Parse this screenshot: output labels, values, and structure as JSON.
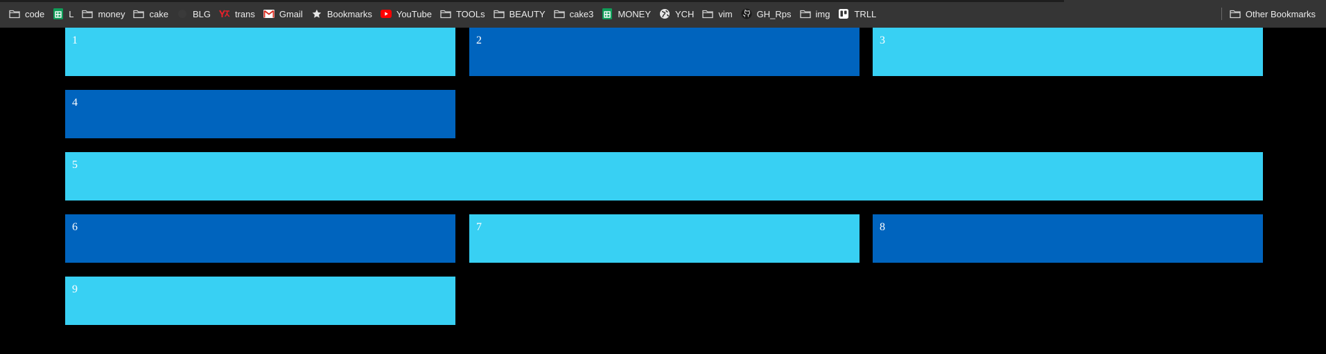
{
  "bookmarks_bar": {
    "items": [
      {
        "label": "code",
        "icon": "folder-icon"
      },
      {
        "label": "L",
        "icon": "sheets-icon"
      },
      {
        "label": "money",
        "icon": "folder-icon"
      },
      {
        "label": "cake",
        "icon": "folder-icon"
      },
      {
        "label": "BLG",
        "icon": "blank-favicon-icon"
      },
      {
        "label": "trans",
        "icon": "yandex-translate-icon"
      },
      {
        "label": "Gmail",
        "icon": "gmail-icon"
      },
      {
        "label": "Bookmarks",
        "icon": "star-icon"
      },
      {
        "label": "YouTube",
        "icon": "youtube-icon"
      },
      {
        "label": "TOOLs",
        "icon": "folder-icon"
      },
      {
        "label": "BEAUTY",
        "icon": "folder-icon"
      },
      {
        "label": "cake3",
        "icon": "folder-icon"
      },
      {
        "label": "MONEY",
        "icon": "sheets-icon"
      },
      {
        "label": "YCH",
        "icon": "globe-icon"
      },
      {
        "label": "vim",
        "icon": "folder-icon"
      },
      {
        "label": "GH_Rps",
        "icon": "github-icon"
      },
      {
        "label": "img",
        "icon": "folder-icon"
      },
      {
        "label": "TRLL",
        "icon": "trello-icon"
      }
    ],
    "other": {
      "label": "Other Bookmarks",
      "icon": "folder-icon"
    }
  },
  "grid": {
    "tiles": [
      "1",
      "2",
      "3",
      "4",
      "5",
      "6",
      "7",
      "8",
      "9"
    ]
  },
  "colors": {
    "light_tile": "#38d0f3",
    "dark_tile": "#0064be",
    "background": "#000000",
    "bar": "#353535"
  }
}
